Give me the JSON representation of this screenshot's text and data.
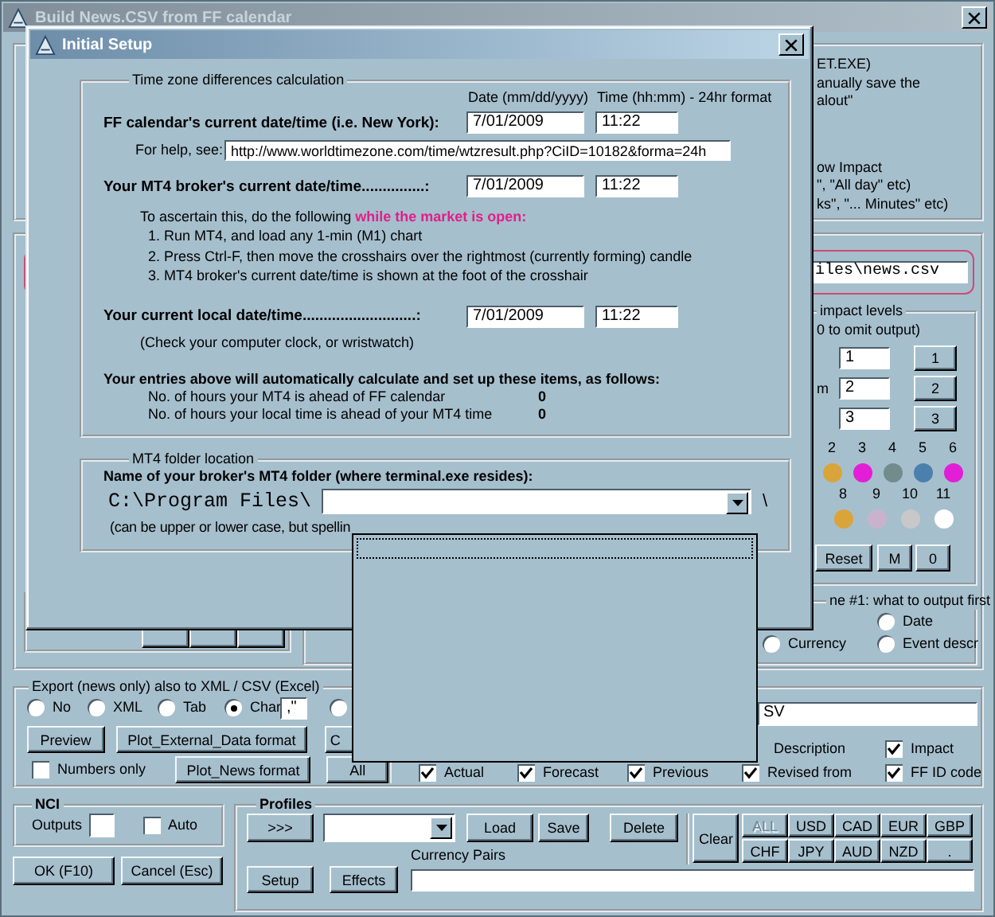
{
  "main_window": {
    "title": "Build News.CSV from FF calendar"
  },
  "notes": {
    "top": [
      "ET.EXE)",
      "anually save the",
      "alout\""
    ],
    "bottom": [
      "ow Impact",
      "\", \"All day\" etc)",
      "ks\", \"... Minutes\" etc)"
    ]
  },
  "output_file": {
    "value": "iles\\news.csv"
  },
  "impact_levels": {
    "legend": "impact levels",
    "hint": "0 to omit output)",
    "rows": [
      {
        "value": "1",
        "button": "1"
      },
      {
        "label": "m",
        "value": "2",
        "button": "2"
      },
      {
        "value": "3",
        "button": "3"
      }
    ]
  },
  "impact_colors": [
    {
      "dots": [
        {
          "label": "2",
          "color": "#d9a53a"
        },
        {
          "label": "3",
          "color": "#e21fd6"
        },
        {
          "label": "4",
          "color": "#728c8c"
        },
        {
          "label": "5",
          "color": "#4c80ac"
        },
        {
          "label": "6",
          "color": "#e21fd6"
        }
      ]
    },
    {
      "dots": [
        {
          "label": "8",
          "color": "#d9a53a"
        },
        {
          "label": "9",
          "color": "#c9b3cc"
        },
        {
          "label": "10",
          "color": "#c8c8c8"
        },
        {
          "label": "11",
          "color": "#ffffff"
        }
      ]
    }
  ],
  "impact_buttons": [
    "Reset",
    "M",
    "0"
  ],
  "output_order": {
    "legend": "ne #1: what to output first",
    "options": [
      {
        "label": "Currency",
        "selected": false
      },
      {
        "label": "Date",
        "selected": false
      },
      {
        "label": "Event descr",
        "selected": false
      }
    ]
  },
  "export": {
    "legend": "Export (news only) also to XML / CSV (Excel)",
    "formats": [
      {
        "label": "No",
        "selected": false
      },
      {
        "label": "XML",
        "selected": false
      },
      {
        "label": "Tab",
        "selected": false
      },
      {
        "label": "Char",
        "selected": true
      }
    ],
    "char_value": ",\"",
    "extra_option": {
      "selected": false
    },
    "buttons": [
      "Preview",
      "Plot_External_Data format",
      "C"
    ],
    "numbers_only": {
      "label": "Numbers only",
      "checked": false
    },
    "plot_news_button": "Plot_News format",
    "all_button": "All",
    "file_value": "SV",
    "fields_row1": [
      {
        "label": "Description",
        "kind": "label"
      },
      {
        "label": "Impact",
        "kind": "checkbox",
        "checked": true
      }
    ],
    "fields_row2": [
      {
        "label": "Actual",
        "checked": true
      },
      {
        "label": "Forecast",
        "checked": true
      },
      {
        "label": "Previous",
        "checked": true
      },
      {
        "label": "Revised from",
        "checked": true
      },
      {
        "label": "FF ID code",
        "checked": true
      }
    ]
  },
  "nci": {
    "legend": "NCI",
    "outputs_label": "Outputs",
    "auto": {
      "label": "Auto",
      "checked": false
    }
  },
  "dialog_buttons": [
    "OK (F10)",
    "Cancel (Esc)"
  ],
  "profiles": {
    "legend": "Profiles",
    "more_button": ">>>",
    "actions": [
      "Load",
      "Save",
      "Delete"
    ],
    "clear_button": "Clear",
    "currencies": [
      {
        "label": "ALL",
        "disabled": true
      },
      {
        "label": "USD",
        "disabled": false
      },
      {
        "label": "CAD",
        "disabled": false
      },
      {
        "label": "EUR",
        "disabled": false
      },
      {
        "label": "GBP",
        "disabled": false
      },
      {
        "label": "CHF",
        "disabled": false
      },
      {
        "label": "JPY",
        "disabled": false
      },
      {
        "label": "AUD",
        "disabled": false
      },
      {
        "label": "NZD",
        "disabled": false
      },
      {
        "label": ".",
        "disabled": false
      }
    ],
    "setup_button": "Setup",
    "effects_button": "Effects",
    "pairs_label": "Currency Pairs"
  },
  "dialog": {
    "title": "Initial Setup",
    "tz_group": {
      "legend": "Time zone differences calculation",
      "date_heading": "Date (mm/dd/yyyy)",
      "time_heading": "Time (hh:mm) - 24hr format",
      "ff_row": {
        "label": "FF calendar's current date/time (i.e. New York):",
        "date": "7/01/2009",
        "time": "11:22"
      },
      "help_label": "For help, see:",
      "help_url": "http://www.worldtimezone.com/time/wtzresult.php?CiID=10182&forma=24h",
      "broker_row": {
        "label": "Your MT4 broker's current date/time...............:",
        "date": "7/01/2009",
        "time": "11:22"
      },
      "intro": "To ascertain this, do the following",
      "intro_highlight": "while the market is open:",
      "steps": [
        "1. Run MT4, and load any 1-min (M1) chart",
        "2. Press Ctrl-F, then move the crosshairs over the rightmost (currently forming) candle",
        "3. MT4 broker's current date/time is shown at the foot of the crosshair"
      ],
      "local_row": {
        "label": "Your current local date/time...........................:",
        "date": "7/01/2009",
        "time": "11:22"
      },
      "local_hint": "(Check your computer clock, or wristwatch)",
      "summary": "Your entries above will automatically calculate and set up these items, as follows:",
      "results": [
        {
          "label": "No. of hours your MT4 is ahead of FF calendar",
          "value": "0"
        },
        {
          "label": "No. of hours your local time is ahead of your MT4 time",
          "value": "0"
        }
      ]
    },
    "folder_group": {
      "legend": "MT4 folder location",
      "label": "Name of your broker's MT4 folder (where terminal.exe resides):",
      "prefix": "C:\\Program Files\\",
      "suffix": "\\",
      "note": "(can be upper or lower case, but spellin"
    }
  }
}
